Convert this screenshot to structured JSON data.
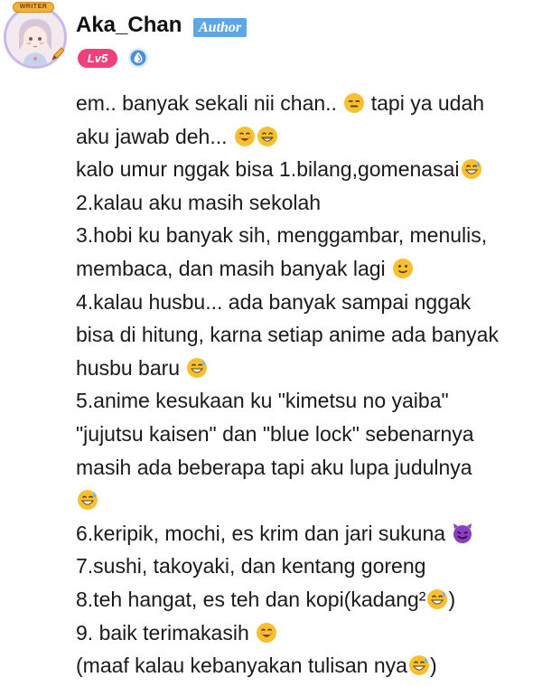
{
  "user": {
    "frame_text": "WRITER",
    "name": "Aka_Chan",
    "role_tag": "Author",
    "level": "Lv5"
  },
  "post": {
    "lines": [
      {
        "text": "em.. banyak sekali nii chan.. ",
        "emoji": [
          "expressionless"
        ],
        "tail": " tapi ya udah"
      },
      {
        "text": "aku jawab deh... ",
        "emoji": [
          "smile",
          "grin"
        ],
        "tail": ""
      },
      {
        "text": "kalo umur nggak bisa 1.bilang,gomenasai",
        "emoji": [
          "sweat-smile"
        ],
        "tail": ""
      },
      {
        "text": "2.kalau aku masih sekolah",
        "emoji": [],
        "tail": ""
      },
      {
        "text": "3.hobi ku banyak sih, menggambar, menulis,",
        "emoji": [],
        "tail": ""
      },
      {
        "text": "membaca, dan masih banyak lagi ",
        "emoji": [
          "slight-smile"
        ],
        "tail": ""
      },
      {
        "text": "4.kalau husbu... ada banyak sampai nggak",
        "emoji": [],
        "tail": ""
      },
      {
        "text": "bisa di hitung, karna setiap anime ada banyak",
        "emoji": [],
        "tail": ""
      },
      {
        "text": "husbu baru ",
        "emoji": [
          "sweat-smile"
        ],
        "tail": ""
      },
      {
        "text": "5.anime kesukaan ku \"kimetsu no yaiba\"",
        "emoji": [],
        "tail": ""
      },
      {
        "text": "\"jujutsu kaisen\" dan \"blue lock\" sebenarnya",
        "emoji": [],
        "tail": ""
      },
      {
        "text": "masih ada beberapa tapi aku lupa judulnya",
        "emoji": [],
        "tail": ""
      },
      {
        "text": "",
        "emoji": [
          "sweat-smile"
        ],
        "tail": ""
      },
      {
        "text": "6.keripik, mochi, es krim dan jari sukuna ",
        "emoji": [
          "smiling-imp"
        ],
        "tail": ""
      },
      {
        "text": "7.sushi, takoyaki, dan kentang goreng",
        "emoji": [],
        "tail": ""
      },
      {
        "text": "8.teh hangat, es teh dan kopi(kadang²",
        "emoji": [
          "sweat-smile"
        ],
        "tail": ")"
      },
      {
        "text": "9. baik terimakasih ",
        "emoji": [
          "smile"
        ],
        "tail": ""
      },
      {
        "text": "(maaf kalau kebanyakan tulisan nya",
        "emoji": [
          "sweat-smile"
        ],
        "tail": ")"
      }
    ]
  },
  "colors": {
    "author_tag": "#5fa6e6",
    "level_badge": "#f0407a",
    "emoji_yellow": "#f7c02e",
    "imp_purple": "#8a3fc0"
  }
}
